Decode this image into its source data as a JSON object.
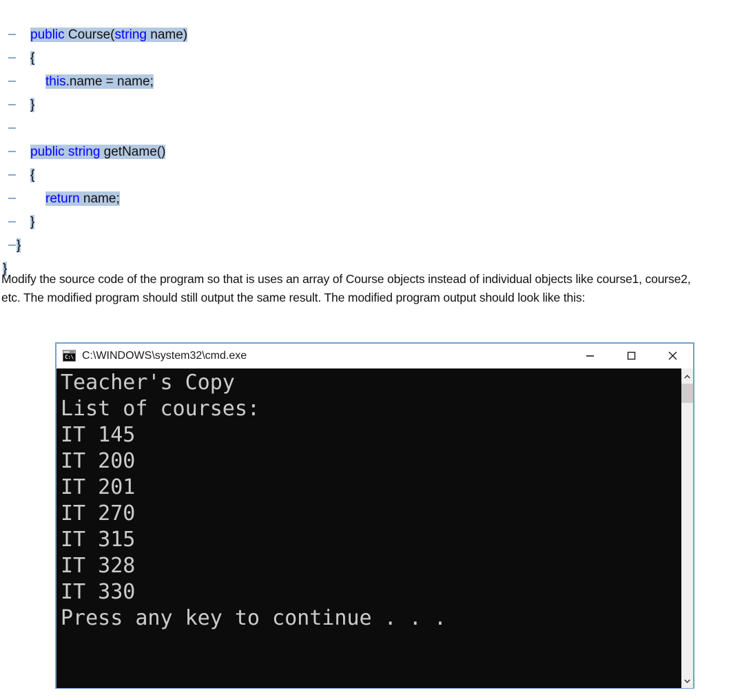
{
  "code": {
    "gutter_marker": "collapse-dash",
    "lines": [
      {
        "indent": 2,
        "tokens": [
          {
            "t": "public ",
            "k": true
          },
          {
            "t": "Course(",
            "k": false
          },
          {
            "t": "string ",
            "k": true
          },
          {
            "t": "name)",
            "k": false
          }
        ]
      },
      {
        "indent": 2,
        "tokens": [
          {
            "t": "{",
            "k": false
          }
        ]
      },
      {
        "indent": 3,
        "tokens": [
          {
            "t": "this",
            "k": true
          },
          {
            "t": ".name = name;",
            "k": false
          }
        ]
      },
      {
        "indent": 2,
        "tokens": [
          {
            "t": "}",
            "k": false
          }
        ]
      },
      {
        "indent": 2,
        "tokens": []
      },
      {
        "indent": 2,
        "tokens": [
          {
            "t": "public ",
            "k": true
          },
          {
            "t": "",
            "k": false
          },
          {
            "t": "string ",
            "k": true
          },
          {
            "t": "getName()",
            "k": false
          }
        ]
      },
      {
        "indent": 2,
        "tokens": [
          {
            "t": "{",
            "k": false
          }
        ]
      },
      {
        "indent": 3,
        "tokens": [
          {
            "t": "return ",
            "k": true
          },
          {
            "t": "name;",
            "k": false
          }
        ]
      },
      {
        "indent": 2,
        "tokens": [
          {
            "t": "}",
            "k": false
          }
        ]
      },
      {
        "indent": 1,
        "tokens": [
          {
            "t": "}",
            "k": false
          }
        ]
      },
      {
        "indent": 0,
        "tokens": [
          {
            "t": "}",
            "k": false
          }
        ],
        "no_gutter": true
      }
    ]
  },
  "instructions": {
    "text": "Modify the source code of the program so that is uses an array of Course objects instead of individual objects like course1, course2, etc. The modified program should still output the same result. The modified program output should look like this:"
  },
  "console": {
    "title": "C:\\WINDOWS\\system32\\cmd.exe",
    "icon": "cmd-console-icon",
    "icon_prompt": "C:\\",
    "window_controls": {
      "minimize": "minimize-button",
      "maximize": "maximize-button",
      "close": "close-button"
    },
    "scrollbar": {
      "up_arrow": "scroll-up-arrow",
      "down_arrow": "scroll-down-arrow",
      "thumb": "scroll-thumb"
    },
    "output_lines": [
      "Teacher's Copy",
      "List of courses:",
      "IT 145",
      "IT 200",
      "IT 201",
      "IT 270",
      "IT 315",
      "IT 328",
      "IT 330",
      "Press any key to continue . . ."
    ]
  },
  "colors": {
    "keyword": "#0000ff",
    "selection": "#b4c9e2",
    "window_border": "#6ba1de",
    "console_bg": "#0c0c0c",
    "console_fg": "#cccccc",
    "gutter_marker": "#8aa8c8"
  }
}
